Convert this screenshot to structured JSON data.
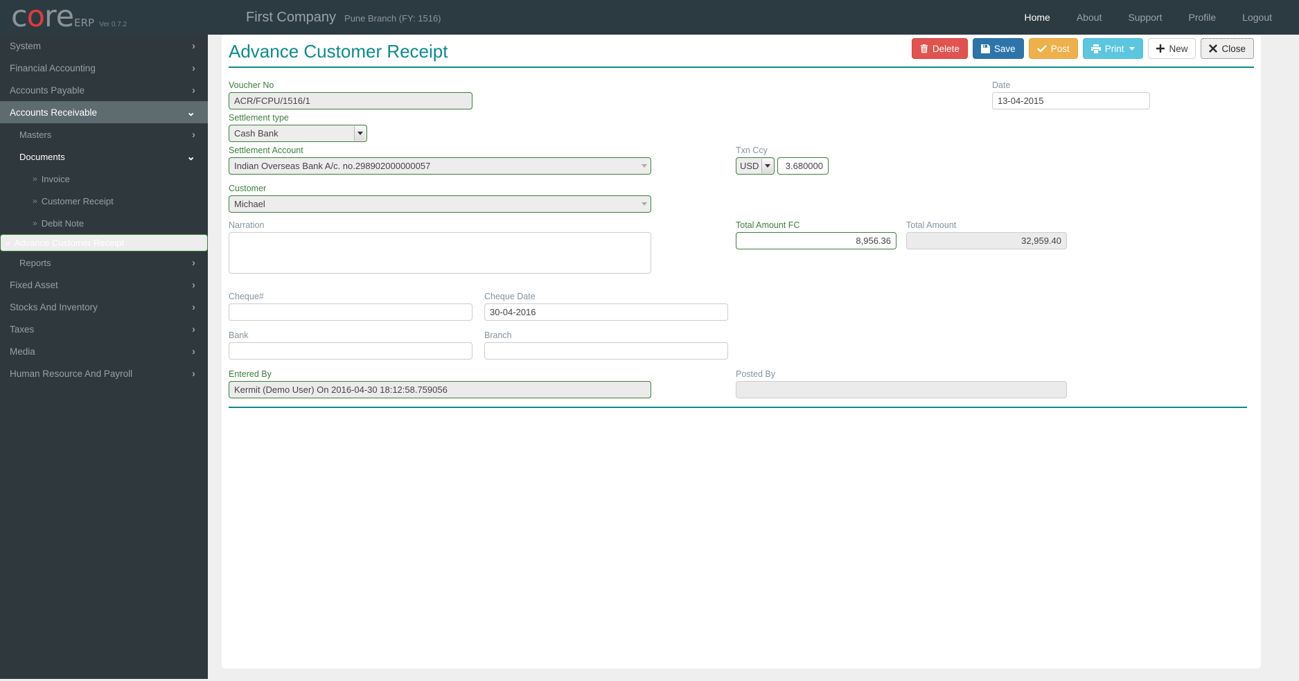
{
  "brand": {
    "logo_core": "core",
    "logo_suffix": "ERP",
    "version": "Ver 0.7.2"
  },
  "header": {
    "company": "First Company",
    "branch": "Pune Branch (FY: 1516)",
    "nav": [
      {
        "label": "Home",
        "active": true
      },
      {
        "label": "About",
        "active": false
      },
      {
        "label": "Support",
        "active": false
      },
      {
        "label": "Profile",
        "active": false
      },
      {
        "label": "Logout",
        "active": false
      }
    ]
  },
  "sidebar": {
    "items": [
      {
        "label": "System",
        "level": 1,
        "chevron": "right"
      },
      {
        "label": "Financial Accounting",
        "level": 1,
        "chevron": "right"
      },
      {
        "label": "Accounts Payable",
        "level": 1,
        "chevron": "right"
      },
      {
        "label": "Accounts Receivable",
        "level": 1,
        "chevron": "down",
        "active": true
      },
      {
        "label": "Masters",
        "level": 2,
        "chevron": "right"
      },
      {
        "label": "Documents",
        "level": 2,
        "chevron": "down",
        "open": true
      },
      {
        "label": "Invoice",
        "level": 3,
        "bullet": "»"
      },
      {
        "label": "Customer Receipt",
        "level": 3,
        "bullet": "»"
      },
      {
        "label": "Debit Note",
        "level": 3,
        "bullet": "»"
      },
      {
        "label": "Advance Customer Receipt",
        "level": 3,
        "bullet": "»",
        "selected": true
      },
      {
        "label": "Reports",
        "level": 2,
        "chevron": "right"
      },
      {
        "label": "Fixed Asset",
        "level": 1,
        "chevron": "right"
      },
      {
        "label": "Stocks And Inventory",
        "level": 1,
        "chevron": "right"
      },
      {
        "label": "Taxes",
        "level": 1,
        "chevron": "right"
      },
      {
        "label": "Media",
        "level": 1,
        "chevron": "right"
      },
      {
        "label": "Human Resource And Payroll",
        "level": 1,
        "chevron": "right"
      }
    ]
  },
  "page": {
    "title": "Advance Customer Receipt",
    "toolbar": {
      "delete": "Delete",
      "save": "Save",
      "post": "Post",
      "print": "Print",
      "new": "New",
      "close": "Close"
    }
  },
  "form": {
    "voucher_no": {
      "label": "Voucher No",
      "value": "ACR/FCPU/1516/1"
    },
    "date": {
      "label": "Date",
      "value": "13-04-2015"
    },
    "settlement_type": {
      "label": "Settlement type",
      "value": "Cash Bank"
    },
    "settlement_account": {
      "label": "Settlement Account",
      "value": "Indian Overseas Bank A/c. no.298902000000057"
    },
    "txn_ccy": {
      "label": "Txn Ccy",
      "currency": "USD",
      "rate": "3.680000"
    },
    "customer": {
      "label": "Customer",
      "value": "Michael"
    },
    "narration": {
      "label": "Narration",
      "value": ""
    },
    "total_amount_fc": {
      "label": "Total Amount FC",
      "value": "8,956.36"
    },
    "total_amount": {
      "label": "Total Amount",
      "value": "32,959.40"
    },
    "cheque_no": {
      "label": "Cheque#",
      "value": ""
    },
    "cheque_date": {
      "label": "Cheque Date",
      "value": "30-04-2016"
    },
    "bank": {
      "label": "Bank",
      "value": ""
    },
    "branch": {
      "label": "Branch",
      "value": ""
    },
    "entered_by": {
      "label": "Entered By",
      "value": "Kermit (Demo User) On 2016-04-30 18:12:58.759056"
    },
    "posted_by": {
      "label": "Posted By",
      "value": ""
    }
  },
  "colors": {
    "accent_teal": "#0c8a90",
    "label_green": "#3e7d3e",
    "label_muted": "#8593a0",
    "navbar_dark": "#2c3a42",
    "sidebar_dark": "#2e383d",
    "danger": "#e0534f",
    "primary": "#2d74ab",
    "warning": "#eeb04b",
    "info": "#5cc6de",
    "brand_red": "#e33b3b"
  }
}
